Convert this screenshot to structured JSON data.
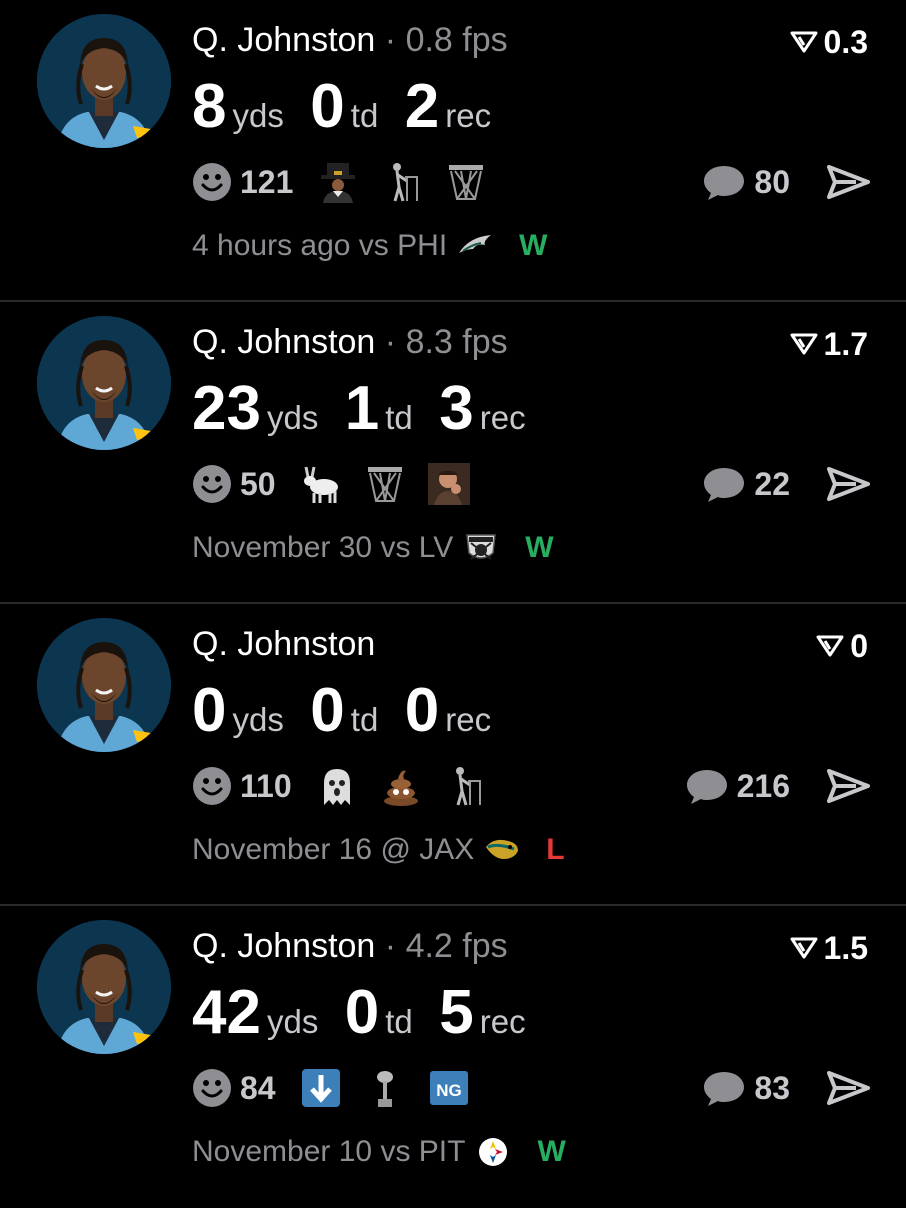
{
  "colors": {
    "background": "#000000",
    "win": "#27ae60",
    "loss": "#e53935",
    "muted": "#8e8e93",
    "avatar_bg": "#0c3550"
  },
  "posts": [
    {
      "player": "Q. Johnston",
      "fps_text": "· 0.8 fps",
      "score": "0.3",
      "yds": "8",
      "yds_label": "yds",
      "td": "0",
      "td_label": "td",
      "rec": "2",
      "rec_label": "rec",
      "reaction_count": "121",
      "reactions": [
        "pilgrim-emoji",
        "elderly-walker-emoji",
        "basketball-hoop-emoji"
      ],
      "comment_count": "80",
      "when": "4 hours ago",
      "venue": "vs",
      "opponent": "PHI",
      "opponent_logo": "eagles-logo",
      "result": "W"
    },
    {
      "player": "Q. Johnston",
      "fps_text": "· 8.3 fps",
      "score": "1.7",
      "yds": "23",
      "yds_label": "yds",
      "td": "1",
      "td_label": "td",
      "rec": "3",
      "rec_label": "rec",
      "reaction_count": "50",
      "reactions": [
        "goat-emoji",
        "basketball-hoop-emoji",
        "praying-man-emoji"
      ],
      "comment_count": "22",
      "when": "November 30",
      "venue": "vs",
      "opponent": "LV",
      "opponent_logo": "raiders-logo",
      "result": "W"
    },
    {
      "player": "Q. Johnston",
      "fps_text": "",
      "score": "0",
      "yds": "0",
      "yds_label": "yds",
      "td": "0",
      "td_label": "td",
      "rec": "0",
      "rec_label": "rec",
      "reaction_count": "110",
      "reactions": [
        "ghost-emoji",
        "poop-emoji",
        "elderly-walker-emoji"
      ],
      "comment_count": "216",
      "when": "November 16",
      "venue": "@",
      "opponent": "JAX",
      "opponent_logo": "jaguars-logo",
      "result": "L"
    },
    {
      "player": "Q. Johnston",
      "fps_text": "· 4.2 fps",
      "score": "1.5",
      "yds": "42",
      "yds_label": "yds",
      "td": "0",
      "td_label": "td",
      "rec": "5",
      "rec_label": "rec",
      "reaction_count": "84",
      "reactions": [
        "down-arrow-emoji",
        "trophy-emoji",
        "ng-badge-emoji"
      ],
      "comment_count": "83",
      "when": "November 10",
      "venue": "vs",
      "opponent": "PIT",
      "opponent_logo": "steelers-logo",
      "result": "W"
    }
  ]
}
